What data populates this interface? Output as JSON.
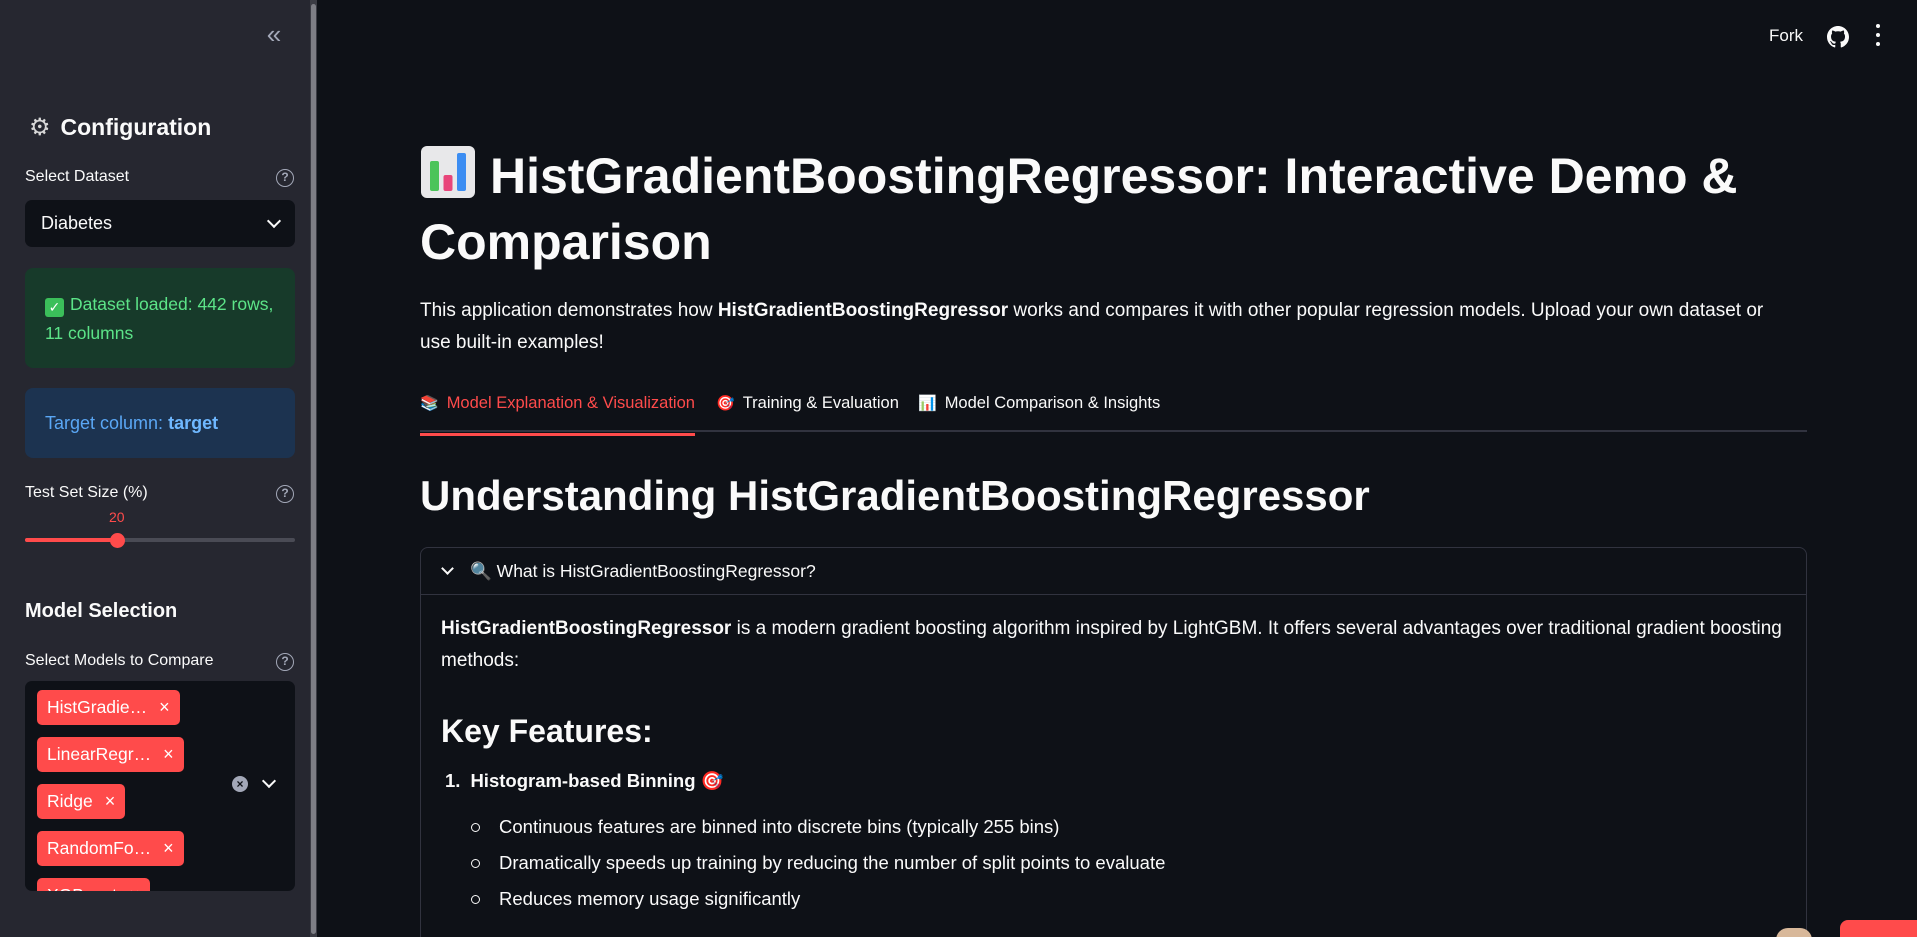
{
  "sidebar": {
    "collapse_icon": "chevrons-left-icon",
    "title": "Configuration",
    "title_icon": "gear-icon",
    "dataset_label": "Select Dataset",
    "dataset_value": "Diabetes",
    "success_msg": "Dataset loaded: 442 rows, 11 columns",
    "target_prefix": "Target column:",
    "target_value": "target",
    "test_size_label": "Test Set Size (%)",
    "test_size_value": "20",
    "test_size_fraction": 0.34,
    "model_selection_title": "Model Selection",
    "models_label": "Select Models to Compare",
    "models": [
      "HistGradie…",
      "LinearRegr…",
      "Ridge",
      "RandomFo…",
      "XGBoost"
    ]
  },
  "topbar": {
    "fork_label": "Fork",
    "github_icon": "github-icon",
    "menu_icon": "kebab-menu-icon"
  },
  "main": {
    "title": "HistGradientBoostingRegressor: Interactive Demo & Comparison",
    "intro_pre": "This application demonstrates how ",
    "intro_bold": "HistGradientBoostingRegressor",
    "intro_post": " works and compares it with other popular regression models. Upload your own dataset or use built-in examples!",
    "tabs": [
      {
        "icon": "📚",
        "label": "Model Explanation & Visualization"
      },
      {
        "icon": "🎯",
        "label": "Training & Evaluation"
      },
      {
        "icon": "📊",
        "label": "Model Comparison & Insights"
      }
    ],
    "section_title": "Understanding HistGradientBoostingRegressor",
    "expander": {
      "title": "What is HistGradientBoostingRegressor?",
      "icon": "🔍",
      "para_bold": "HistGradientBoostingRegressor",
      "para_rest": " is a modern gradient boosting algorithm inspired by LightGBM. It offers several advantages over traditional gradient boosting methods:",
      "features_title": "Key Features:",
      "item1_num": "1.",
      "item1_title": "Histogram-based Binning",
      "item1_icon": "🎯",
      "bullets": [
        "Continuous features are binned into discrete bins (typically 255 bins)",
        "Dramatically speeds up training by reducing the number of split points to evaluate",
        "Reduces memory usage significantly"
      ]
    }
  },
  "colors": {
    "accent": "#ff4b4b",
    "bg": "#0e1117",
    "sidebar_bg": "#262730"
  }
}
